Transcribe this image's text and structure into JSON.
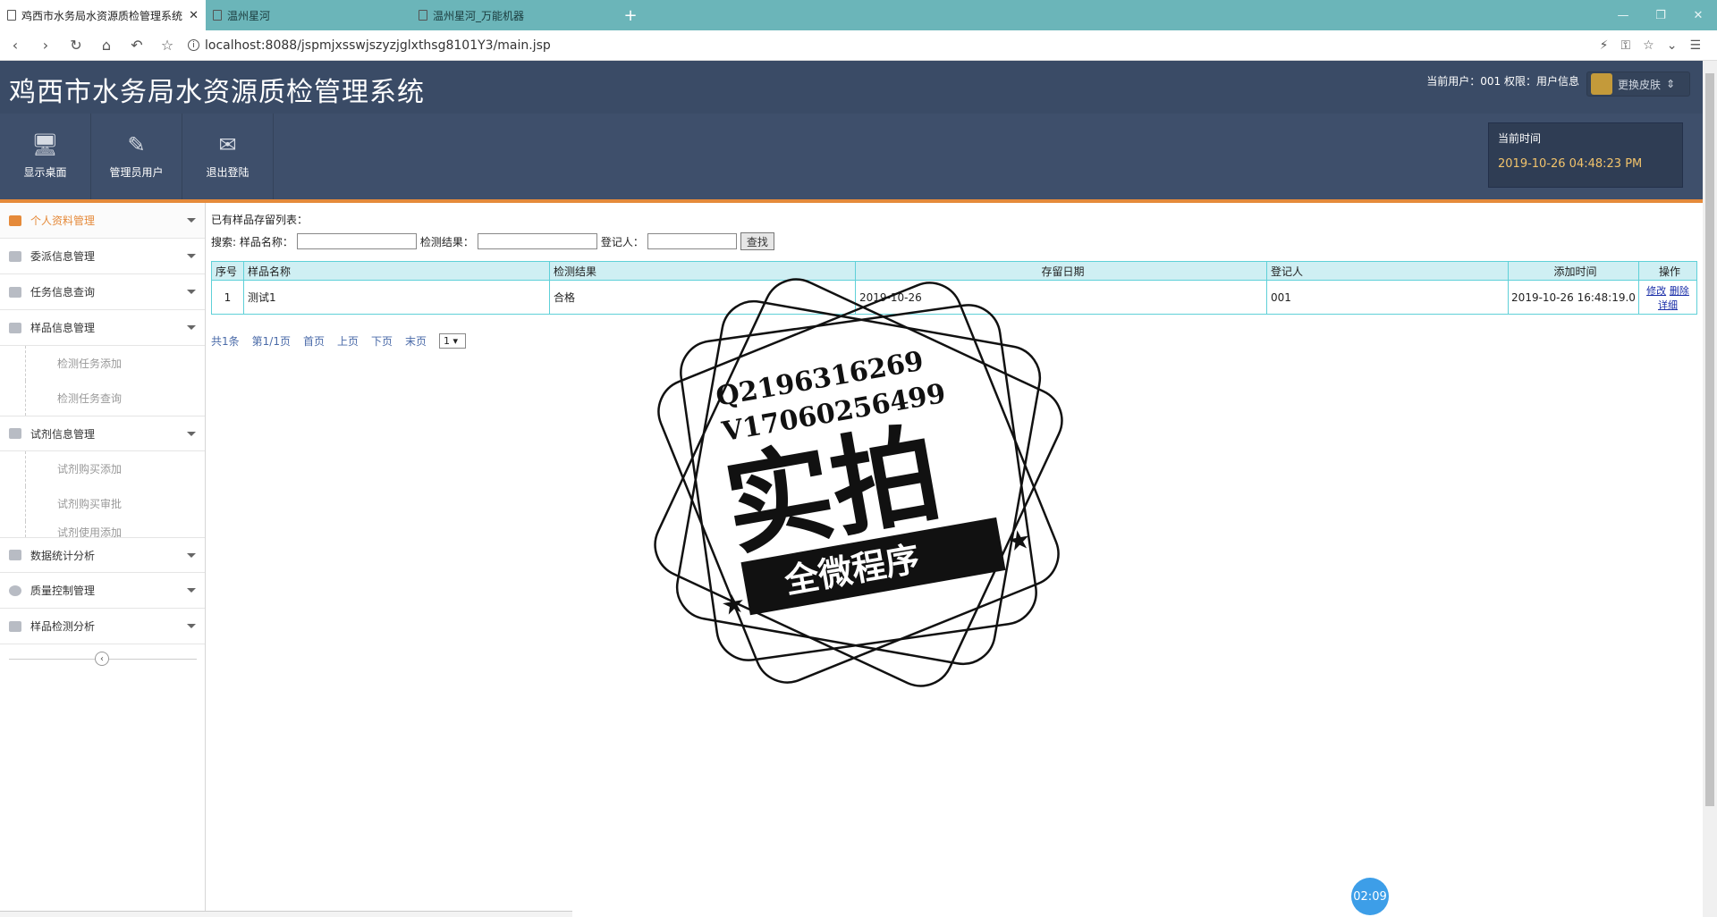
{
  "browser": {
    "tabs": [
      {
        "title": "鸡西市水务局水资源质检管理系统",
        "active": true
      },
      {
        "title": "温州星河",
        "active": false
      },
      {
        "title": "温州星河_万能机器",
        "active": false
      }
    ],
    "url": "localhost:8088/jspmjxsswjszyzjglxthsg8101Y3/main.jsp"
  },
  "header": {
    "title": "鸡西市水务局水资源质检管理系统",
    "user_info": "当前用户：001 权限：用户信息",
    "skin_label": "更换皮肤"
  },
  "toolbar": {
    "items": [
      {
        "label": "显示桌面",
        "icon": "monitor-icon"
      },
      {
        "label": "管理员用户",
        "icon": "pencil-icon"
      },
      {
        "label": "退出登陆",
        "icon": "envelope-icon"
      }
    ],
    "time_label": "当前时间",
    "time_value": "2019-10-26 04:48:23 PM"
  },
  "sidebar": {
    "menus": [
      {
        "label": "个人资料管理",
        "active": true
      },
      {
        "label": "委派信息管理"
      },
      {
        "label": "任务信息查询"
      },
      {
        "label": "样品信息管理"
      },
      {
        "label": "试剂信息管理"
      },
      {
        "label": "数据统计分析"
      },
      {
        "label": "质量控制管理"
      },
      {
        "label": "样品检测分析"
      }
    ],
    "sample_subs": [
      "检测任务添加",
      "检测任务查询"
    ],
    "reagent_subs": [
      "试剂购买添加",
      "试剂购买审批",
      "试剂使用添加"
    ]
  },
  "main": {
    "caption": "已有样品存留列表：",
    "search": {
      "prefix": "搜索: 样品名称：",
      "result_label": "检测结果：",
      "registrar_label": "登记人：",
      "button": "查找"
    },
    "table": {
      "headers": [
        "序号",
        "样品名称",
        "检测结果",
        "存留日期",
        "登记人",
        "添加时间",
        "操作"
      ],
      "rows": [
        {
          "no": "1",
          "name": "测试1",
          "result": "合格",
          "date": "2019-10-26",
          "registrar": "001",
          "added": "2019-10-26 16:48:19.0",
          "edit": "修改",
          "delete": "删除",
          "detail": "详细"
        }
      ]
    },
    "pager": {
      "total": "共1条",
      "page": "第1/1页",
      "first": "首页",
      "prev": "上页",
      "next": "下页",
      "last": "末页",
      "select_value": "1 ▾"
    }
  },
  "watermark": {
    "qq": "Q2196316269",
    "wx": "V17060256499",
    "main": "实拍",
    "banner": "全微程序"
  },
  "timer": "02:09"
}
